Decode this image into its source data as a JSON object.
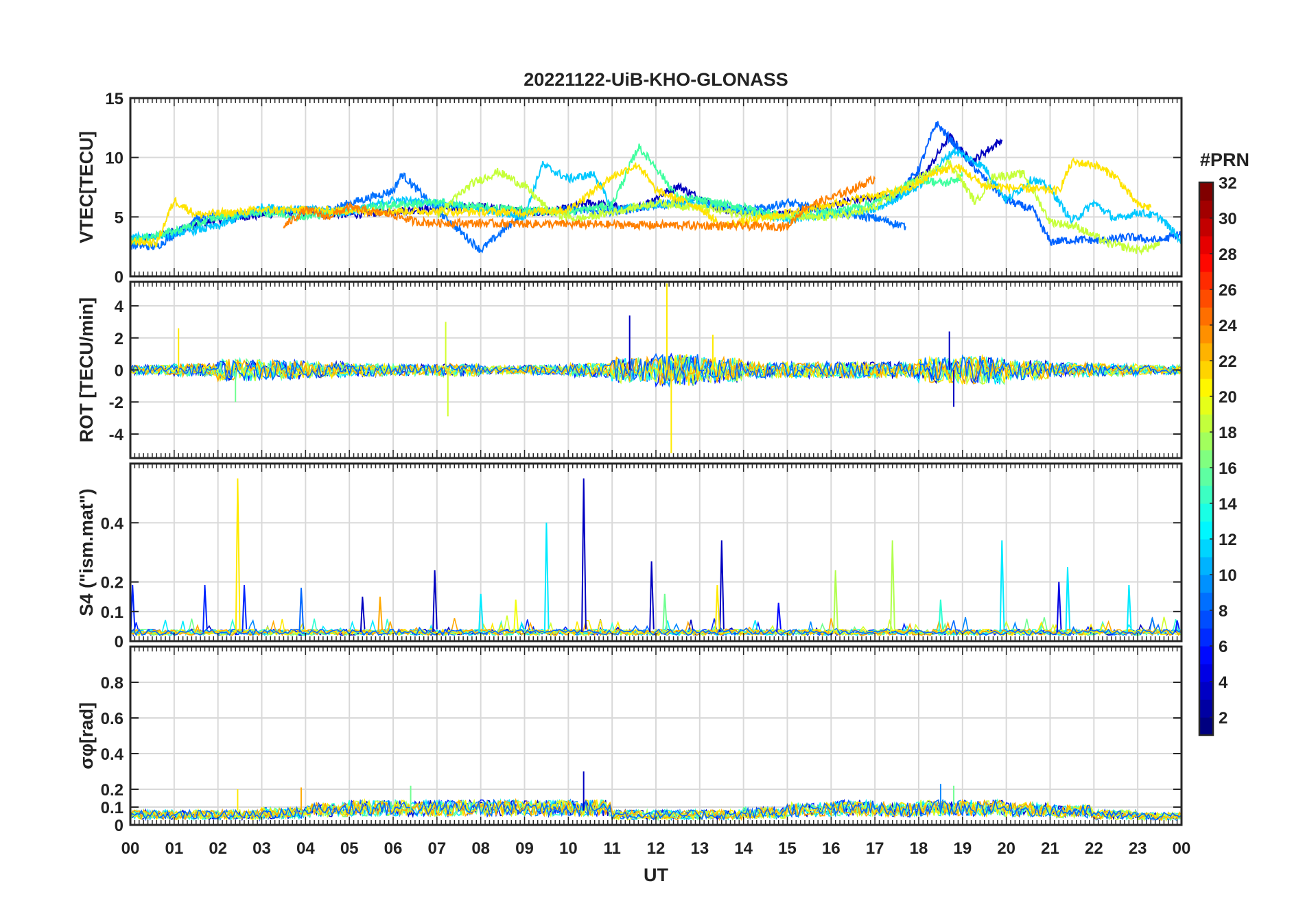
{
  "figure": {
    "title": "20221122-UiB-KHO-GLONASS",
    "xlabel": "UT",
    "x_ticks": [
      "00",
      "01",
      "02",
      "03",
      "04",
      "05",
      "06",
      "07",
      "08",
      "09",
      "10",
      "11",
      "12",
      "13",
      "14",
      "15",
      "16",
      "17",
      "18",
      "19",
      "20",
      "21",
      "22",
      "23",
      "00"
    ]
  },
  "colorbar": {
    "title": "#PRN",
    "ticks": [
      "2",
      "4",
      "6",
      "8",
      "10",
      "12",
      "14",
      "16",
      "18",
      "20",
      "22",
      "24",
      "26",
      "28",
      "30",
      "32"
    ],
    "range": [
      1,
      32
    ],
    "colormap": "jet"
  },
  "chart_data": [
    {
      "type": "line",
      "panel": "vtec",
      "ylabel": "VTEC[TECU]",
      "x_unit": "hours UT",
      "xlim": [
        0,
        24
      ],
      "ylim": [
        0,
        15
      ],
      "yticks": [
        "0",
        "5",
        "10",
        "15"
      ],
      "grid": true,
      "series": [
        {
          "prn": 3,
          "color": "#0000bf",
          "x": [
            0.0,
            0.8,
            2.0,
            3.5,
            5.0,
            6.5,
            8.0,
            9.5,
            10.5,
            11.5,
            12.5,
            13.5,
            15.0,
            16.5,
            17.5,
            18.2,
            18.7,
            19.2,
            19.9
          ],
          "values": [
            2.8,
            3.6,
            4.8,
            5.4,
            5.2,
            5.6,
            5.9,
            5.3,
            6.2,
            5.6,
            7.6,
            5.6,
            5.2,
            6.4,
            6.8,
            8.9,
            11.8,
            9.6,
            11.5
          ]
        },
        {
          "prn": 9,
          "color": "#0070ff",
          "x": [
            0.0,
            0.6,
            1.5,
            3.0,
            4.5,
            6.0,
            6.2,
            7.0,
            8.0,
            9.0,
            10.0,
            11.0,
            12.0,
            13.0,
            14.0,
            15.0,
            16.0,
            17.0,
            17.7
          ],
          "values": [
            2.6,
            2.5,
            4.8,
            5.4,
            5.6,
            7.2,
            8.6,
            5.6,
            2.2,
            5.4,
            5.6,
            5.4,
            6.0,
            6.4,
            5.4,
            6.2,
            5.4,
            4.9,
            4.2
          ]
        },
        {
          "prn": 8,
          "color": "#0060ff",
          "x": [
            17.5,
            18.0,
            18.4,
            18.8,
            19.4,
            20.0,
            20.6,
            21.0,
            21.6,
            22.2,
            22.8,
            23.5,
            24.0
          ],
          "values": [
            6.8,
            9.0,
            12.9,
            11.2,
            8.6,
            6.4,
            5.6,
            2.9,
            3.1,
            3.0,
            3.3,
            3.0,
            3.6
          ]
        },
        {
          "prn": 12,
          "color": "#00c8ff",
          "x": [
            0.0,
            1.0,
            2.0,
            3.0,
            4.0,
            5.0,
            6.0,
            7.0,
            8.0,
            9.0,
            9.4,
            10.0,
            10.6,
            11.0,
            12.0,
            13.0,
            14.0,
            15.0,
            16.0,
            17.0,
            18.0,
            18.8,
            19.5,
            20.0,
            20.6,
            21.0,
            21.5,
            22.0,
            22.5,
            23.0,
            23.5,
            24.0
          ],
          "values": [
            3.2,
            3.6,
            4.2,
            5.8,
            5.6,
            5.4,
            6.4,
            6.2,
            5.6,
            5.0,
            9.4,
            8.2,
            8.6,
            5.6,
            6.0,
            6.2,
            5.6,
            4.8,
            5.2,
            5.6,
            7.6,
            10.6,
            9.2,
            6.4,
            8.2,
            7.4,
            4.6,
            6.2,
            4.8,
            5.4,
            5.0,
            3.0
          ]
        },
        {
          "prn": 16,
          "color": "#40ff9f",
          "x": [
            0.0,
            1.0,
            2.0,
            3.0,
            4.0,
            5.0,
            6.0,
            7.0,
            8.0,
            9.0,
            10.0,
            11.0,
            11.6,
            12.0,
            12.5,
            13.0,
            14.0,
            15.0,
            16.0,
            17.0,
            18.0,
            18.6,
            19.0
          ],
          "values": [
            3.0,
            3.8,
            5.0,
            5.4,
            5.0,
            5.6,
            6.0,
            6.2,
            5.8,
            5.6,
            5.4,
            6.0,
            10.9,
            9.2,
            6.6,
            6.4,
            5.8,
            5.0,
            5.4,
            6.2,
            8.2,
            7.8,
            8.4
          ]
        },
        {
          "prn": 19,
          "color": "#c6ff3a",
          "x": [
            7.0,
            7.8,
            8.4,
            9.0,
            9.6,
            10.2,
            11.0,
            12.0,
            13.0,
            14.0,
            15.5,
            16.4,
            17.0,
            18.0,
            18.7,
            19.3,
            19.7,
            20.4,
            21.0,
            21.6,
            22.3,
            23.0,
            23.5
          ],
          "values": [
            5.2,
            7.8,
            8.8,
            7.6,
            5.4,
            4.8,
            5.4,
            6.2,
            5.8,
            5.2,
            4.9,
            5.2,
            5.8,
            8.2,
            9.6,
            6.2,
            8.4,
            8.6,
            4.6,
            4.2,
            2.8,
            2.2,
            2.6
          ]
        },
        {
          "prn": 21,
          "color": "#ffe300",
          "x": [
            0.0,
            0.6,
            1.0,
            1.5,
            2.5,
            3.0,
            9.0,
            10.0,
            11.0,
            11.6,
            12.0,
            13.0,
            13.5,
            17.8,
            18.4,
            18.9,
            19.5,
            21.2,
            21.5,
            22.0,
            22.5,
            23.0,
            23.3
          ],
          "values": [
            3.0,
            2.8,
            6.4,
            5.2,
            5.4,
            5.6,
            5.4,
            5.6,
            8.4,
            9.4,
            7.2,
            5.8,
            4.2,
            7.4,
            8.8,
            9.2,
            7.6,
            7.2,
            9.6,
            9.4,
            8.4,
            6.0,
            5.8
          ]
        },
        {
          "prn": 23,
          "color": "#ff8000",
          "x": [
            3.5,
            4.0,
            4.5,
            5.0,
            5.5,
            6.0,
            6.5,
            7.0,
            15.0,
            15.4,
            16.0,
            16.4,
            17.0
          ],
          "values": [
            4.2,
            5.6,
            5.0,
            5.8,
            5.4,
            5.2,
            4.6,
            4.5,
            4.2,
            5.8,
            6.6,
            7.2,
            8.2
          ]
        }
      ]
    },
    {
      "type": "line",
      "panel": "rot",
      "ylabel": "ROT [TECU/min]",
      "x_unit": "hours UT",
      "xlim": [
        0,
        24
      ],
      "ylim": [
        -5.5,
        5.5
      ],
      "yticks": [
        "-4",
        "-2",
        "0",
        "2",
        "4"
      ],
      "grid": true,
      "noise_amplitude_by_hour": [
        0.3,
        0.4,
        0.7,
        0.6,
        0.5,
        0.4,
        0.35,
        0.4,
        0.25,
        0.3,
        0.45,
        0.8,
        1.0,
        0.8,
        0.5,
        0.5,
        0.5,
        0.5,
        0.8,
        0.9,
        0.6,
        0.45,
        0.4,
        0.3,
        0.3
      ],
      "spikes": [
        {
          "x": 1.1,
          "value": 2.6,
          "prn": 21
        },
        {
          "x": 2.4,
          "value": -2.0,
          "prn": 16
        },
        {
          "x": 7.2,
          "value": 3.0,
          "prn": 19
        },
        {
          "x": 7.25,
          "value": -2.9,
          "prn": 19
        },
        {
          "x": 11.4,
          "value": 3.4,
          "prn": 3
        },
        {
          "x": 12.25,
          "value": 5.4,
          "prn": 21
        },
        {
          "x": 12.35,
          "value": -5.2,
          "prn": 21
        },
        {
          "x": 13.3,
          "value": 2.2,
          "prn": 21
        },
        {
          "x": 18.8,
          "value": -2.3,
          "prn": 3
        },
        {
          "x": 18.7,
          "value": 2.4,
          "prn": 3
        }
      ]
    },
    {
      "type": "line",
      "panel": "s4",
      "ylabel": "S4 (\"ism.mat\")",
      "x_unit": "hours UT",
      "xlim": [
        0,
        24
      ],
      "ylim": [
        0,
        0.6
      ],
      "yticks": [
        "0",
        "0.1",
        "0.2",
        "0.4"
      ],
      "grid": true,
      "baseline": 0.02,
      "spikes": [
        {
          "x": 0.05,
          "value": 0.19,
          "prn": 6
        },
        {
          "x": 1.7,
          "value": 0.19,
          "prn": 6
        },
        {
          "x": 2.45,
          "value": 0.55,
          "prn": 21
        },
        {
          "x": 2.6,
          "value": 0.19,
          "prn": 6
        },
        {
          "x": 3.9,
          "value": 0.18,
          "prn": 8
        },
        {
          "x": 5.3,
          "value": 0.15,
          "prn": 3
        },
        {
          "x": 5.7,
          "value": 0.15,
          "prn": 23
        },
        {
          "x": 6.95,
          "value": 0.24,
          "prn": 3
        },
        {
          "x": 8.0,
          "value": 0.16,
          "prn": 12
        },
        {
          "x": 8.8,
          "value": 0.14,
          "prn": 20
        },
        {
          "x": 9.5,
          "value": 0.4,
          "prn": 12
        },
        {
          "x": 10.35,
          "value": 0.55,
          "prn": 3
        },
        {
          "x": 11.9,
          "value": 0.27,
          "prn": 3
        },
        {
          "x": 12.2,
          "value": 0.16,
          "prn": 16
        },
        {
          "x": 13.5,
          "value": 0.34,
          "prn": 3
        },
        {
          "x": 13.4,
          "value": 0.19,
          "prn": 21
        },
        {
          "x": 14.8,
          "value": 0.13,
          "prn": 5
        },
        {
          "x": 16.1,
          "value": 0.24,
          "prn": 18
        },
        {
          "x": 17.4,
          "value": 0.34,
          "prn": 18
        },
        {
          "x": 18.5,
          "value": 0.14,
          "prn": 14
        },
        {
          "x": 19.9,
          "value": 0.34,
          "prn": 12
        },
        {
          "x": 21.2,
          "value": 0.2,
          "prn": 4
        },
        {
          "x": 21.4,
          "value": 0.25,
          "prn": 12
        },
        {
          "x": 22.8,
          "value": 0.19,
          "prn": 12
        },
        {
          "x": 23.9,
          "value": 0.07,
          "prn": 6
        }
      ]
    },
    {
      "type": "line",
      "panel": "sigma_phi",
      "ylabel": "σφ[rad]",
      "x_unit": "hours UT",
      "xlim": [
        0,
        24
      ],
      "ylim": [
        0,
        1.0
      ],
      "yticks": [
        "0",
        "0.1",
        "0.2",
        "0.4",
        "0.6",
        "0.8"
      ],
      "grid": true,
      "level_by_hour": [
        0.06,
        0.06,
        0.06,
        0.07,
        0.09,
        0.1,
        0.1,
        0.1,
        0.1,
        0.1,
        0.1,
        0.06,
        0.06,
        0.06,
        0.07,
        0.09,
        0.1,
        0.09,
        0.1,
        0.1,
        0.09,
        0.08,
        0.06,
        0.05,
        0.05
      ],
      "spikes": [
        {
          "x": 2.45,
          "value": 0.2,
          "prn": 21
        },
        {
          "x": 3.9,
          "value": 0.21,
          "prn": 23
        },
        {
          "x": 6.4,
          "value": 0.22,
          "prn": 16
        },
        {
          "x": 10.35,
          "value": 0.3,
          "prn": 3
        },
        {
          "x": 18.5,
          "value": 0.23,
          "prn": 9
        },
        {
          "x": 18.8,
          "value": 0.22,
          "prn": 16
        }
      ]
    }
  ]
}
